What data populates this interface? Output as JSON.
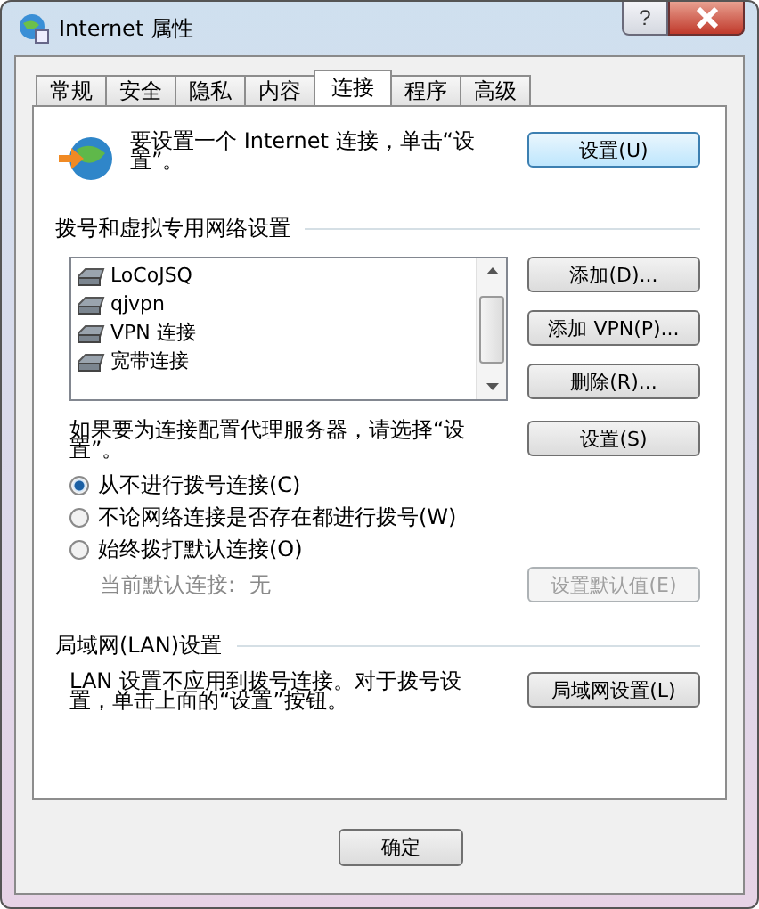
{
  "window": {
    "title": "Internet 属性",
    "help": "?"
  },
  "tabs": [
    {
      "label": "常规",
      "selected": false
    },
    {
      "label": "安全",
      "selected": false
    },
    {
      "label": "隐私",
      "selected": false
    },
    {
      "label": "内容",
      "selected": false
    },
    {
      "label": "连接",
      "selected": true
    },
    {
      "label": "程序",
      "selected": false
    },
    {
      "label": "高级",
      "selected": false
    }
  ],
  "setup": {
    "text": "要设置一个 Internet 连接，单击“设置”。",
    "button": "设置(U)"
  },
  "vpn": {
    "heading": "拨号和虚拟专用网络设置",
    "connections": [
      {
        "name": "LoCoJSQ"
      },
      {
        "name": "qjvpn"
      },
      {
        "name": "VPN 连接"
      },
      {
        "name": "宽带连接"
      }
    ],
    "buttons": [
      "添加(D)...",
      "添加 VPN(P)...",
      "删除(R)..."
    ]
  },
  "proxy": {
    "text": "如果要为连接配置代理服务器，请选择“设置”。",
    "button": "设置(S)"
  },
  "dial_options": [
    {
      "label": "从不进行拨号连接(C)",
      "selected": true
    },
    {
      "label": "不论网络连接是否存在都进行拨号(W)",
      "selected": false
    },
    {
      "label": "始终拨打默认连接(O)",
      "selected": false
    }
  ],
  "default_connection": {
    "label": "当前默认连接:",
    "value": "无",
    "button": {
      "label": "设置默认值(E)",
      "disabled": true
    }
  },
  "lan": {
    "heading": "局域网(LAN)设置",
    "text": "LAN 设置不应用到拨号连接。对于拨号设置，单击上面的“设置”按钮。",
    "button": "局域网设置(L)"
  },
  "footer_buttons": [
    {
      "label": "确定"
    }
  ]
}
